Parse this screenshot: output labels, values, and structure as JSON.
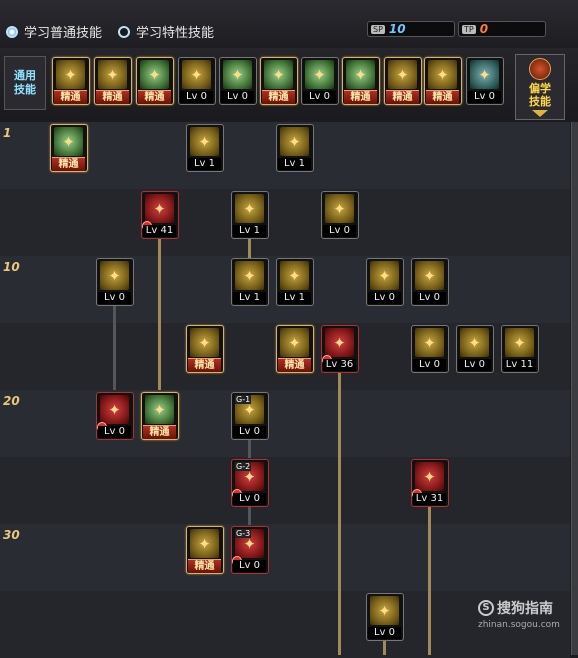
{
  "header": {
    "learn_normal_label": "学习普通技能",
    "learn_special_label": "学习特性技能",
    "sp_tag": "SP",
    "sp_value": "10",
    "tp_tag": "TP",
    "tp_value": "0",
    "colors": {
      "sp_value": "#6fc7ff",
      "tp_value": "#ff7a3a"
    }
  },
  "tabs": {
    "general_label": "通用技能",
    "offclass_label": "偏学技能"
  },
  "general_skills": [
    {
      "icon": "sitting-figure-icon",
      "status": "精通",
      "art": "yellow"
    },
    {
      "icon": "kneeling-figure-icon",
      "status": "精通",
      "art": "yellow"
    },
    {
      "icon": "running-figure-icon",
      "status": "精通",
      "art": "green"
    },
    {
      "icon": "wings-emblem-icon",
      "status": "Lv 0",
      "art": "yellow"
    },
    {
      "icon": "target-green-icon",
      "status": "Lv 0",
      "art": "green"
    },
    {
      "icon": "target-green-icon",
      "status": "精通",
      "art": "green"
    },
    {
      "icon": "soldier-icon",
      "status": "Lv 0",
      "art": "green"
    },
    {
      "icon": "soldier-icon",
      "status": "精通",
      "art": "green"
    },
    {
      "icon": "eye-icon",
      "status": "精通",
      "art": "yellow"
    },
    {
      "icon": "muscle-figure-icon",
      "status": "精通",
      "art": "yellow"
    },
    {
      "icon": "figure-green-icon",
      "status": "Lv 0",
      "art": "teal"
    }
  ],
  "level_labels": [
    "1",
    "10",
    "20",
    "30"
  ],
  "skills": [
    {
      "icon": "green-book-icon",
      "status": "精通",
      "art": "green",
      "g": ""
    },
    {
      "icon": "grab-arrow-icon",
      "status": "Lv 1",
      "art": "yellow",
      "g": ""
    },
    {
      "icon": "kick-icon",
      "status": "Lv 1",
      "art": "yellow",
      "g": ""
    },
    {
      "icon": "burst-red-icon",
      "status": "Lv 41",
      "art": "red",
      "g": ""
    },
    {
      "icon": "rush-lines-icon",
      "status": "Lv 1",
      "art": "yellow",
      "g": ""
    },
    {
      "icon": "gun-icon",
      "status": "Lv 0",
      "art": "yellow",
      "g": ""
    },
    {
      "icon": "slash-icon",
      "status": "Lv 0",
      "art": "yellow",
      "g": ""
    },
    {
      "icon": "flame-fist-icon",
      "status": "Lv 1",
      "art": "yellow",
      "g": ""
    },
    {
      "icon": "spear-icon",
      "status": "Lv 1",
      "art": "yellow",
      "g": ""
    },
    {
      "icon": "arrow-up-icon",
      "status": "Lv 0",
      "art": "yellow",
      "g": ""
    },
    {
      "icon": "beast-icon",
      "status": "Lv 0",
      "art": "yellow",
      "g": ""
    },
    {
      "icon": "whirl-icon",
      "status": "精通",
      "art": "yellow",
      "g": ""
    },
    {
      "icon": "robot-icon",
      "status": "精通",
      "art": "yellow",
      "g": ""
    },
    {
      "icon": "red-burst-icon",
      "status": "Lv 36",
      "art": "red",
      "g": ""
    },
    {
      "icon": "kick2-icon",
      "status": "Lv 0",
      "art": "yellow",
      "g": ""
    },
    {
      "icon": "mountain-icon",
      "status": "Lv 0",
      "art": "yellow",
      "g": ""
    },
    {
      "icon": "grenade-icon",
      "status": "Lv 11",
      "art": "yellow",
      "g": ""
    },
    {
      "icon": "tornado-red-icon",
      "status": "Lv 0",
      "art": "red",
      "g": ""
    },
    {
      "icon": "green-orbs-icon",
      "status": "精通",
      "art": "green",
      "g": ""
    },
    {
      "icon": "g1-icon",
      "status": "Lv 0",
      "art": "yellow",
      "g": "G-1"
    },
    {
      "icon": "g2-icon",
      "status": "Lv 0",
      "art": "red",
      "g": "G-2"
    },
    {
      "icon": "turret-red-icon",
      "status": "Lv 31",
      "art": "red",
      "g": ""
    },
    {
      "icon": "megaphone-icon",
      "status": "精通",
      "art": "yellow",
      "g": ""
    },
    {
      "icon": "g3-icon",
      "status": "Lv 0",
      "art": "red",
      "g": "G-3"
    },
    {
      "icon": "figure-yellow-icon",
      "status": "Lv 0",
      "art": "yellow",
      "g": ""
    }
  ],
  "watermark": {
    "text": "搜狗指南",
    "logo": "S",
    "url": "zhinan.sogou.com"
  }
}
